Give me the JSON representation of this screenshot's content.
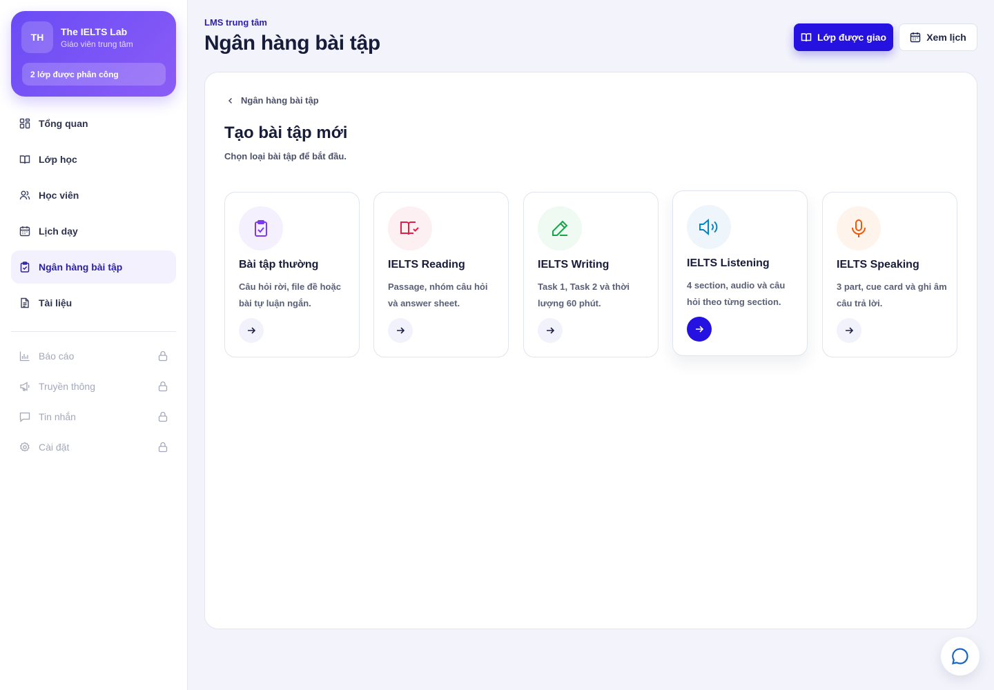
{
  "sidebar": {
    "profile": {
      "initials": "TH",
      "org_name": "The IELTS Lab",
      "role": "Giáo viên trung tâm",
      "assigned": "2 lớp được phân công"
    },
    "items": [
      {
        "label": "Tổng quan",
        "icon": "grid-icon"
      },
      {
        "label": "Lớp học",
        "icon": "book-open-icon"
      },
      {
        "label": "Học viên",
        "icon": "users-icon"
      },
      {
        "label": "Lịch dạy",
        "icon": "calendar-icon"
      },
      {
        "label": "Ngân hàng bài tập",
        "icon": "clipboard-check-icon",
        "active": true
      },
      {
        "label": "Tài liệu",
        "icon": "document-icon"
      }
    ],
    "locked_items": [
      {
        "label": "Báo cáo",
        "icon": "bar-chart-icon"
      },
      {
        "label": "Truyền thông",
        "icon": "megaphone-icon"
      },
      {
        "label": "Tin nhắn",
        "icon": "message-icon"
      },
      {
        "label": "Cài đặt",
        "icon": "settings-icon"
      }
    ]
  },
  "header": {
    "eyebrow": "LMS trung tâm",
    "title": "Ngân hàng bài tập",
    "primary_button": "Lớp được giao",
    "secondary_button": "Xem lịch"
  },
  "main": {
    "breadcrumb": "Ngân hàng bài tập",
    "title": "Tạo bài tập mới",
    "subtitle": "Chọn loại bài tập để bắt đầu.",
    "cards": [
      {
        "title": "Bài tập thường",
        "desc": "Câu hỏi rời, file đề hoặc bài tự luận ngắn.",
        "icon": "clipboard-check-icon",
        "color": "#7c3aed",
        "bg": "#f4f0fe"
      },
      {
        "title": "IELTS Reading",
        "desc": "Passage, nhóm câu hỏi và answer sheet.",
        "icon": "book-check-icon",
        "color": "#e11d48",
        "bg": "#fdf0f2"
      },
      {
        "title": "IELTS Writing",
        "desc": "Task 1, Task 2 và thời lượng 60 phút.",
        "icon": "pen-icon",
        "color": "#16a34a",
        "bg": "#eefaf2"
      },
      {
        "title": "IELTS Listening",
        "desc": "4 section, audio và câu hỏi theo từng section.",
        "icon": "speaker-icon",
        "color": "#0284c7",
        "bg": "#eef6fc",
        "active": true
      },
      {
        "title": "IELTS Speaking",
        "desc": "3 part, cue card và ghi âm câu trả lời.",
        "icon": "microphone-icon",
        "color": "#ea580c",
        "bg": "#fef4ec"
      }
    ]
  },
  "colors": {
    "accent": "#2511e0",
    "brand_gradient_start": "#6a4cf5",
    "brand_gradient_end": "#8b5cf6"
  }
}
